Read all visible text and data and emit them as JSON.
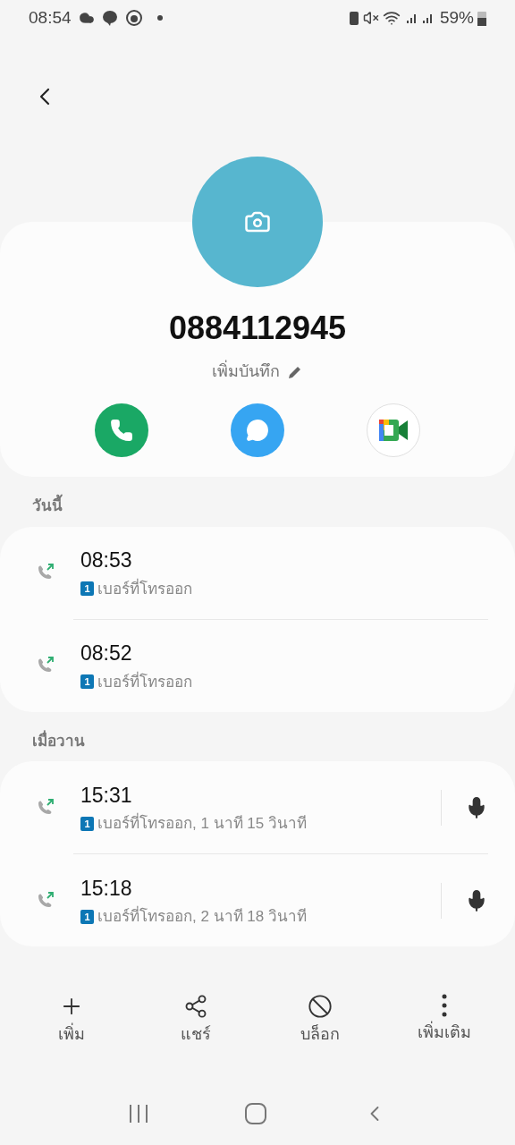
{
  "status_bar": {
    "time": "08:54",
    "battery": "59%"
  },
  "contact": {
    "number": "0884112945",
    "note": "เพิ่มบันทึก"
  },
  "sections": [
    {
      "title": "วันนี้",
      "calls": [
        {
          "time": "08:53",
          "sim": "1",
          "detail": "เบอร์ที่โทรออก",
          "recording": false
        },
        {
          "time": "08:52",
          "sim": "1",
          "detail": "เบอร์ที่โทรออก",
          "recording": false
        }
      ]
    },
    {
      "title": "เมื่อวาน",
      "calls": [
        {
          "time": "15:31",
          "sim": "1",
          "detail": "เบอร์ที่โทรออก, 1 นาที 15 วินาที",
          "recording": true
        },
        {
          "time": "15:18",
          "sim": "1",
          "detail": "เบอร์ที่โทรออก, 2 นาที 18 วินาที",
          "recording": true
        }
      ]
    }
  ],
  "actions": [
    {
      "kind": "add",
      "label": "เพิ่ม"
    },
    {
      "kind": "share",
      "label": "แชร์"
    },
    {
      "kind": "block",
      "label": "บล็อก"
    },
    {
      "kind": "more",
      "label": "เพิ่มเติม"
    }
  ]
}
